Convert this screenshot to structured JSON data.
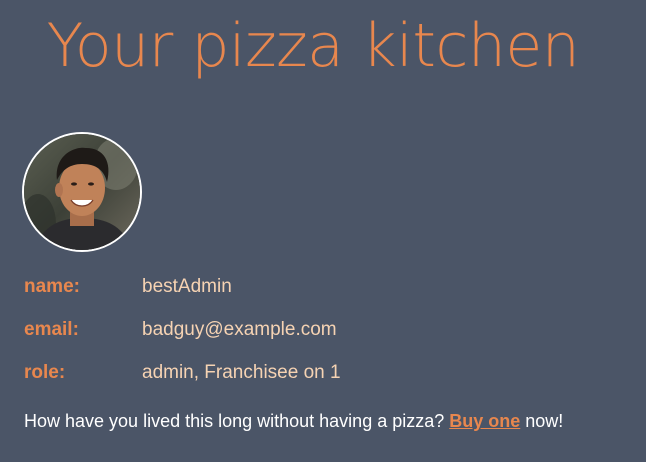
{
  "header": {
    "title": "Your pizza kitchen"
  },
  "profile": {
    "avatar_alt": "user avatar",
    "fields": [
      {
        "label": "name:",
        "value": "bestAdmin"
      },
      {
        "label": "email:",
        "value": "badguy@example.com"
      },
      {
        "label": "role:",
        "value": "admin, Franchisee on 1"
      }
    ]
  },
  "cta": {
    "prefix": "How have you lived this long without having a pizza? ",
    "link_label": "Buy one",
    "suffix": " now!"
  },
  "colors": {
    "background": "#4b5567",
    "accent": "#e8874e",
    "value_text": "#f6d3b3",
    "body_text": "#ffffff"
  }
}
